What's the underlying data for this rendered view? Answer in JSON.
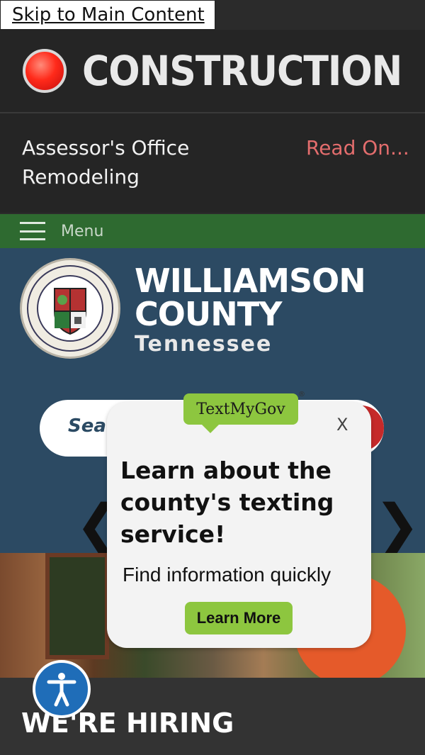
{
  "skip_link": "Skip to Main Content",
  "alert": {
    "title": "CONSTRUCTION",
    "message": "Assessor's Office Remodeling",
    "read_more": "Read On..."
  },
  "menu": {
    "label": "Menu"
  },
  "brand": {
    "line1": "WILLIAMSON",
    "line2": "COUNTY",
    "line3": "Tennessee",
    "seal_text": "WILLIAMSON COUNTY TENNESSEE THE GREAT SEAL"
  },
  "search": {
    "placeholder": "Sea"
  },
  "carousel": {
    "prev": "❮",
    "next": "❯"
  },
  "banner": {
    "title": "WE'RE HIRING"
  },
  "popup": {
    "logo": "TextMyGov",
    "registered": "®",
    "close": "X",
    "heading": "Learn about the county's texting service!",
    "subtext": "Find information quickly",
    "button": "Learn More"
  },
  "colors": {
    "alert_bg": "#252525",
    "menu_bar": "#2e6a30",
    "hero_bg": "#2c4a63",
    "popup_accent": "#8dc63f",
    "a11y": "#1f6db8"
  }
}
